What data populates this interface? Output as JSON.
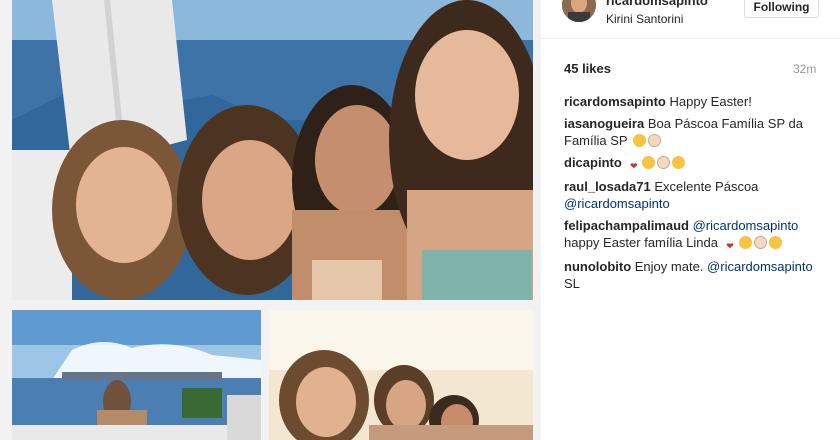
{
  "post": {
    "username": "ricardomsapinto",
    "location": "Kirini Santorini",
    "follow_label": "Following",
    "likes": "45 likes",
    "time": "32m"
  },
  "comments": [
    {
      "user": "ricardomsapinto",
      "text": "Happy Easter!"
    },
    {
      "user": "iasanogueira",
      "text": "Boa Páscoa Família SP da Família SP"
    },
    {
      "user": "dicapinto",
      "text": ""
    },
    {
      "user": "raul_losada71",
      "text": "Excelente Páscoa",
      "mention": "@ricardomsapinto"
    },
    {
      "user": "felipachampalimaud",
      "mention": "@ricardomsapinto",
      "text": "happy Easter família Linda"
    },
    {
      "user": "nunolobito",
      "text": "Enjoy mate.",
      "mention": "@ricardomsapinto",
      "text_after": "SL"
    }
  ],
  "colors": {
    "mention": "#003569",
    "sea": "#3f74a8",
    "sky": "#7fb0d6"
  },
  "icons": [
    "avatar-photo",
    "emoji-face",
    "emoji-heart",
    "emoji-hands"
  ]
}
